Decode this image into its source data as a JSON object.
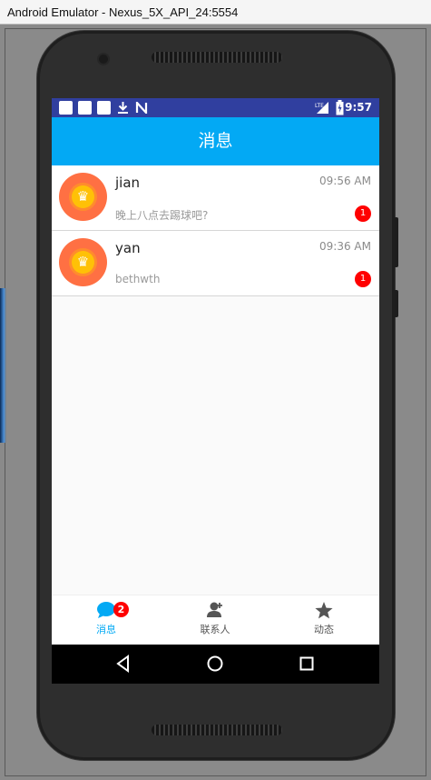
{
  "window": {
    "title": "Android Emulator - Nexus_5X_API_24:5554"
  },
  "status_bar": {
    "time": "9:57",
    "icons": [
      "notification-square",
      "notification-square",
      "notification-square",
      "download-icon",
      "n-icon",
      "lte-signal-icon",
      "battery-icon"
    ],
    "colors": {
      "background": "#303f9f"
    }
  },
  "app_bar": {
    "title": "消息",
    "color": "#03a9f4"
  },
  "messages": [
    {
      "name": "jian",
      "time": "09:56 AM",
      "preview": "晚上八点去踢球吧?",
      "unread": "1",
      "avatar_icon": "crown-icon"
    },
    {
      "name": "yan",
      "time": "09:36 AM",
      "preview": "bethwth",
      "unread": "1",
      "avatar_icon": "crown-icon"
    }
  ],
  "bottom_nav": {
    "items": [
      {
        "label": "消息",
        "icon": "chat-bubble-icon",
        "badge": "2",
        "active": true
      },
      {
        "label": "联系人",
        "icon": "contacts-icon",
        "active": false
      },
      {
        "label": "动态",
        "icon": "star-icon",
        "active": false
      }
    ],
    "active_color": "#03a9f4",
    "inactive_color": "#555555"
  },
  "system_nav": {
    "buttons": [
      "back-icon",
      "home-icon",
      "recents-icon"
    ]
  }
}
